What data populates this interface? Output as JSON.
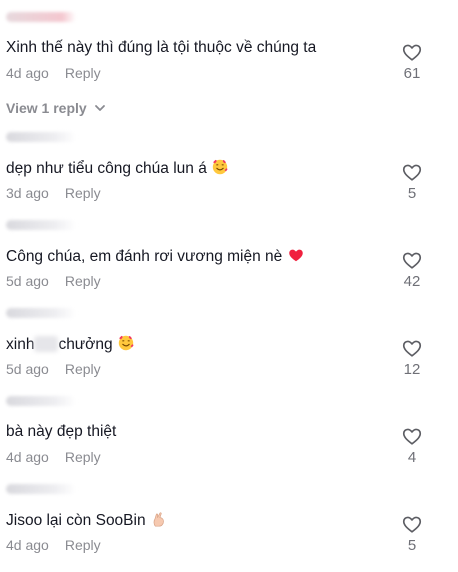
{
  "comments": [
    {
      "text": "Xinh thế này thì đúng là tội thuộc về chúng ta",
      "time": "4d ago",
      "reply": "Reply",
      "likes": "61",
      "view_replies": "View 1 reply"
    },
    {
      "text": "dẹp như tiểu công chúa lun á",
      "time": "3d ago",
      "reply": "Reply",
      "likes": "5",
      "emoji": "smiling-face-with-hearts"
    },
    {
      "text": "Công chúa, em đánh rơi vương miện nè",
      "time": "5d ago",
      "reply": "Reply",
      "likes": "42",
      "emoji": "red-heart"
    },
    {
      "text_start": "xinh",
      "text_end": "chưởng",
      "time": "5d ago",
      "reply": "Reply",
      "likes": "12",
      "emoji": "smiling-face-with-hearts"
    },
    {
      "text": "bà này đẹp thiệt",
      "time": "4d ago",
      "reply": "Reply",
      "likes": "4"
    },
    {
      "text": "Jisoo lại còn SooBin",
      "time": "4d ago",
      "reply": "Reply",
      "likes": "5",
      "emoji": "pinching-hand"
    }
  ],
  "colors": {
    "text": "#161823",
    "muted": "#8a8b91",
    "heart_red": "#fe2c55"
  }
}
